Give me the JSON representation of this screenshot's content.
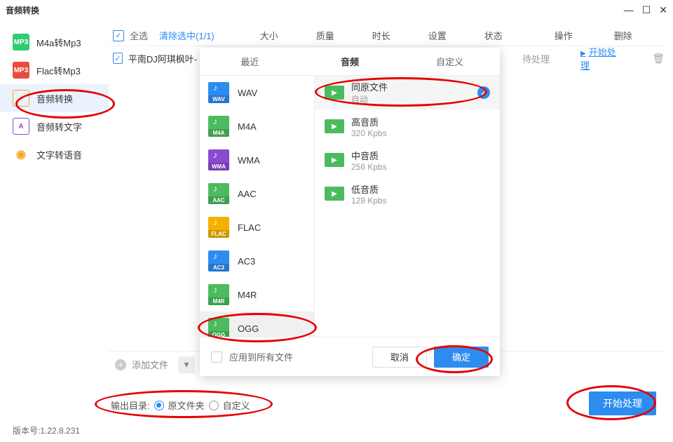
{
  "window": {
    "title": "音频转换"
  },
  "sidebar": {
    "items": [
      {
        "label": "M4a转Mp3"
      },
      {
        "label": "Flac转Mp3"
      },
      {
        "label": "音频转换"
      },
      {
        "label": "音频转文字"
      },
      {
        "label": "文字转语音"
      }
    ]
  },
  "header": {
    "select_all": "全选",
    "clear": "清除选中(1/1)",
    "size": "大小",
    "quality": "质量",
    "duration": "时长",
    "settings": "设置",
    "status": "状态",
    "action": "操作",
    "delete": "删除"
  },
  "row": {
    "filename": "平南DJ阿琪枫叶-",
    "status": "待处理",
    "start": "开始处理"
  },
  "panel": {
    "tabs": [
      "最近",
      "音频",
      "自定义"
    ],
    "formats": [
      {
        "label": "WAV",
        "color": "#2d8cf0"
      },
      {
        "label": "M4A",
        "color": "#4cbb5f"
      },
      {
        "label": "WMA",
        "color": "#8a4ad1"
      },
      {
        "label": "AAC",
        "color": "#4cbb5f"
      },
      {
        "label": "FLAC",
        "color": "#f5b100"
      },
      {
        "label": "AC3",
        "color": "#2d8cf0"
      },
      {
        "label": "M4R",
        "color": "#4cbb5f"
      },
      {
        "label": "OGG",
        "color": "#4cbb5f"
      }
    ],
    "qualities": [
      {
        "label": "同原文件",
        "sub": "自动",
        "selected": true
      },
      {
        "label": "高音质",
        "sub": "320 Kpbs"
      },
      {
        "label": "中音质",
        "sub": "256 Kpbs"
      },
      {
        "label": "低音质",
        "sub": "128 Kpbs"
      }
    ],
    "apply_all": "应用到所有文件",
    "cancel": "取消",
    "ok": "确定"
  },
  "bottom": {
    "add_file": "添加文件"
  },
  "output": {
    "label": "输出目录:",
    "original": "原文件夹",
    "custom": "自定义"
  },
  "start_button": "开始处理",
  "version": "版本号:1.22.8.231"
}
